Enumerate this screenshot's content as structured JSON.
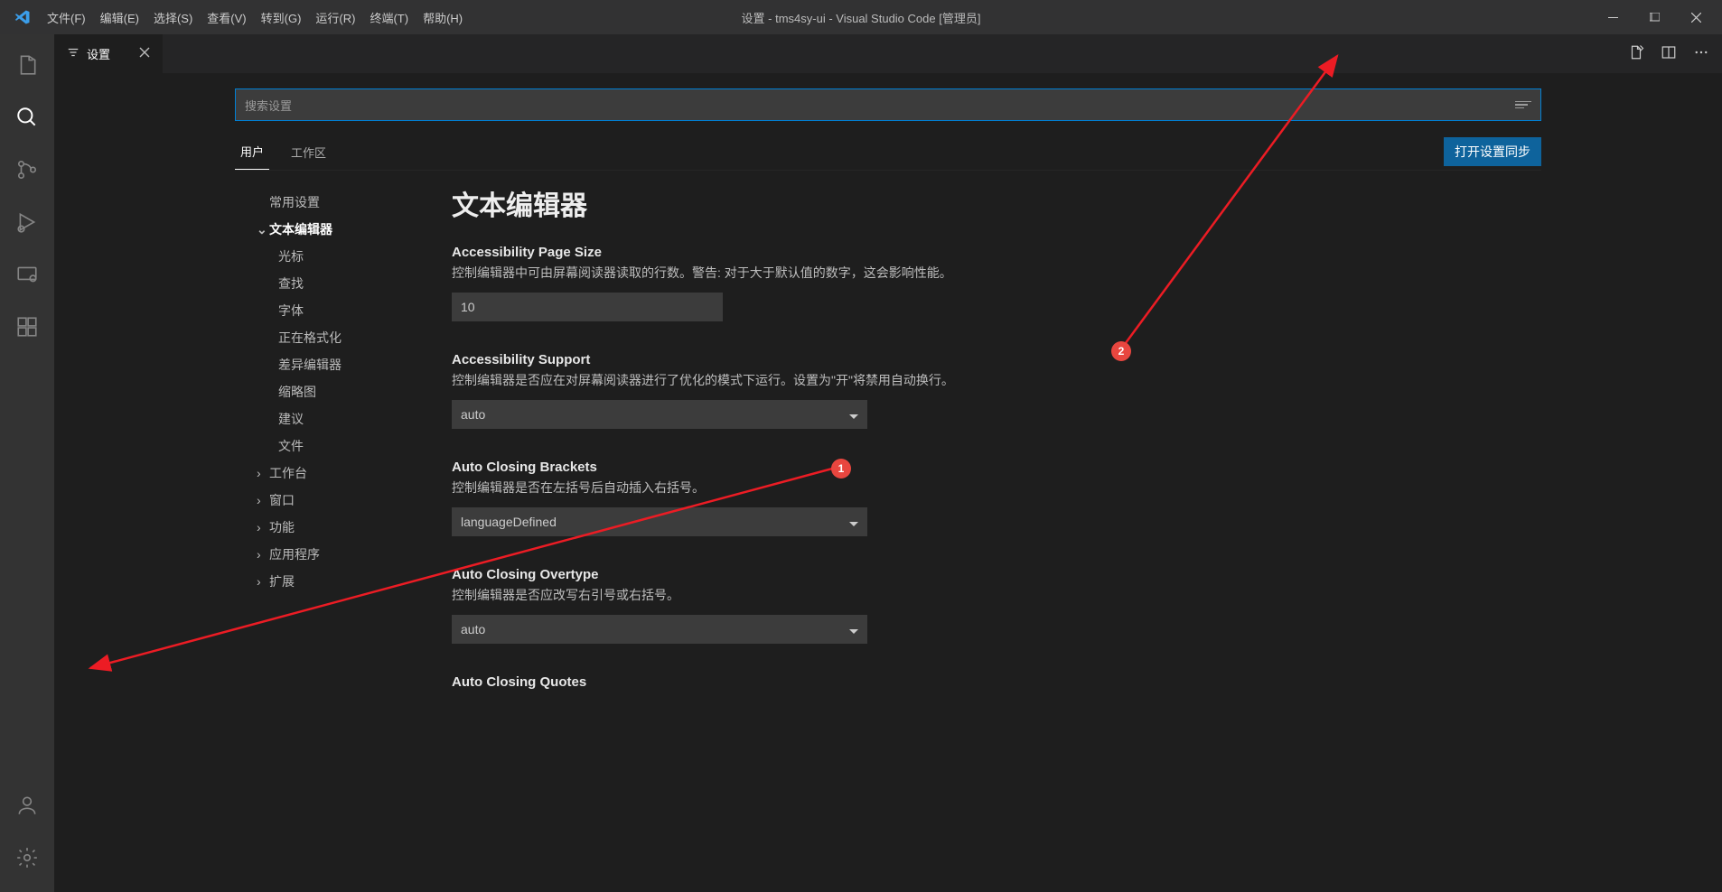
{
  "titlebar": {
    "menus": [
      "文件(F)",
      "编辑(E)",
      "选择(S)",
      "查看(V)",
      "转到(G)",
      "运行(R)",
      "终端(T)",
      "帮助(H)"
    ],
    "title": "设置 - tms4sy-ui - Visual Studio Code [管理员]"
  },
  "tab": {
    "label": "设置"
  },
  "search": {
    "placeholder": "搜索设置"
  },
  "scope": {
    "user": "用户",
    "workspace": "工作区",
    "sync_button": "打开设置同步"
  },
  "toc": {
    "common": "常用设置",
    "textEditor": "文本编辑器",
    "children": [
      "光标",
      "查找",
      "字体",
      "正在格式化",
      "差异编辑器",
      "缩略图",
      "建议",
      "文件"
    ],
    "workbench": "工作台",
    "window": "窗口",
    "features": "功能",
    "application": "应用程序",
    "extensions": "扩展"
  },
  "content": {
    "heading": "文本编辑器",
    "s1": {
      "title": "Accessibility Page Size",
      "desc": "控制编辑器中可由屏幕阅读器读取的行数。警告: 对于大于默认值的数字，这会影响性能。",
      "value": "10"
    },
    "s2": {
      "title": "Accessibility Support",
      "desc": "控制编辑器是否应在对屏幕阅读器进行了优化的模式下运行。设置为\"开\"将禁用自动换行。",
      "value": "auto"
    },
    "s3": {
      "title": "Auto Closing Brackets",
      "desc": "控制编辑器是否在左括号后自动插入右括号。",
      "value": "languageDefined"
    },
    "s4": {
      "title": "Auto Closing Overtype",
      "desc": "控制编辑器是否应改写右引号或右括号。",
      "value": "auto"
    },
    "s5": {
      "title": "Auto Closing Quotes"
    }
  },
  "annotation": {
    "b1": "1",
    "b2": "2"
  }
}
